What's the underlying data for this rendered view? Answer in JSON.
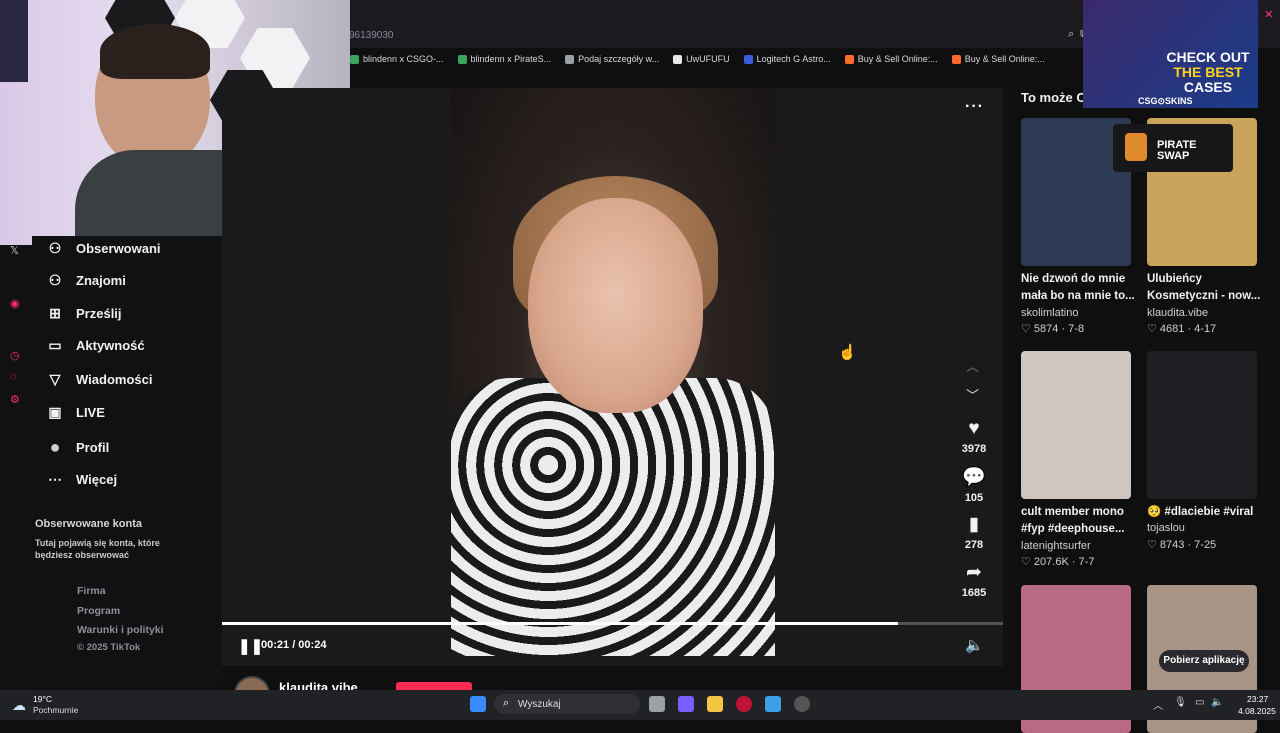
{
  "browser": {
    "url_fragment": "96139030",
    "bookmarks": [
      {
        "label": "blindenn x CSGO-...",
        "color": "#3ba55d"
      },
      {
        "label": "blindenn x PirateS...",
        "color": "#3ba55d"
      },
      {
        "label": "Podaj szczegóły w...",
        "color": "#9aa0a6"
      },
      {
        "label": "UwUFUFU",
        "color": "#e8e8e8"
      },
      {
        "label": "Logitech G Astro...",
        "color": "#3b5bdb"
      },
      {
        "label": "Buy & Sell Online:...",
        "color": "#ff6b2c"
      },
      {
        "label": "Buy & Sell Online:...",
        "color": "#ff6b2c"
      }
    ]
  },
  "sidebar": {
    "items": [
      {
        "label": "Obserwowani",
        "icon": "followers-icon",
        "glyph": "⚇"
      },
      {
        "label": "Znajomi",
        "icon": "friends-icon",
        "glyph": "⚇"
      },
      {
        "label": "Prześlij",
        "icon": "upload-icon",
        "glyph": "⊞"
      },
      {
        "label": "Aktywność",
        "icon": "activity-icon",
        "glyph": "▭"
      },
      {
        "label": "Wiadomości",
        "icon": "messages-icon",
        "glyph": "▽"
      },
      {
        "label": "LIVE",
        "icon": "live-icon",
        "glyph": "▣"
      },
      {
        "label": "Profil",
        "icon": "profile-icon",
        "glyph": "●"
      },
      {
        "label": "Więcej",
        "icon": "more-icon",
        "glyph": "⋯"
      }
    ],
    "followed_title": "Obserwowane konta",
    "followed_desc": "Tutaj pojawią się konta, które będziesz obserwować",
    "footer": [
      "Firma",
      "Program",
      "Warunki i polityki",
      "© 2025 TikTok"
    ]
  },
  "player": {
    "time": "00:21 / 00:24",
    "progress": 0.866,
    "likes": "3978",
    "comments": "105",
    "saves": "278",
    "shares": "1685",
    "author": "klaudita.vibe"
  },
  "right": {
    "title": "To może C",
    "cards": [
      {
        "title": "Nie dzwoń do mnie mała bo na mnie to...",
        "author": "skolimlatino",
        "stats": "♡ 5874 · 7-8",
        "bg": "#2f3b55"
      },
      {
        "title": "Ulubieńcy Kosmetyczni - now...",
        "author": "klaudita.vibe",
        "stats": "♡ 4681 · 4-17",
        "bg": "#c8a45a"
      },
      {
        "title": "cult member mono #fyp #deephouse...",
        "author": "latenightsurfer",
        "stats": "♡ 207.6K · 7-7",
        "bg": "#cfc6c0"
      },
      {
        "title": "🥺 #dlaciebie #viral",
        "author": "tojaslou",
        "stats": "♡ 8743 · 7-25",
        "bg": "#1d1f22"
      },
      {
        "title": "",
        "author": "",
        "stats": "",
        "bg": "#b86a82"
      },
      {
        "title": "",
        "author": "",
        "stats": "",
        "bg": "#a89484"
      }
    ],
    "get_app": "Pobierz aplikację"
  },
  "ads": {
    "cases_line1": "CHECK OUT",
    "cases_line2": "THE BEST",
    "cases_line3": "CASES",
    "cases_brand": "CSG⊙SKINS",
    "pirate_line1": "PIRATE",
    "pirate_line2": "SWAP"
  },
  "taskbar": {
    "temp": "19°C",
    "weather": "Pochmurnie",
    "search": "Wyszukaj",
    "time": "23:27",
    "date": "4.08.2025"
  }
}
